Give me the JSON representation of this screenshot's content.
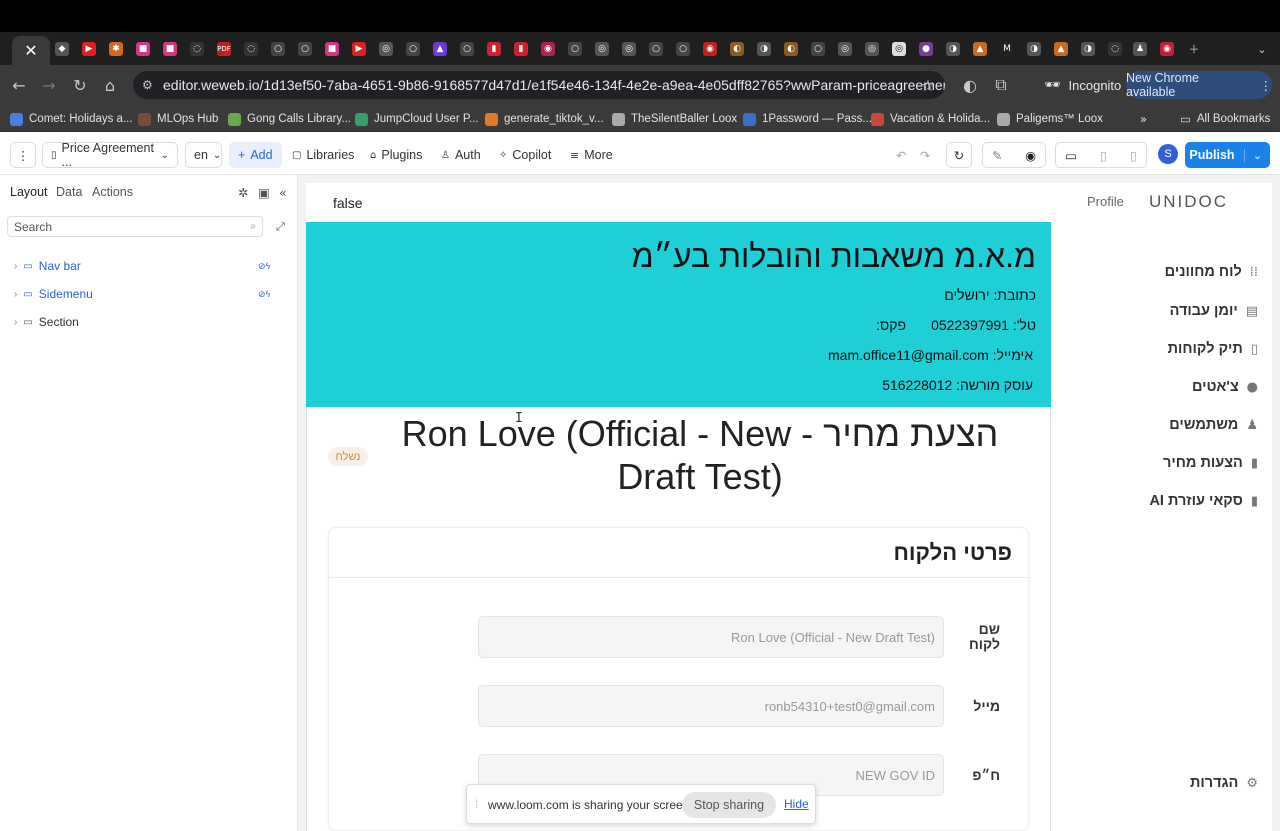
{
  "browser": {
    "url": "editor.weweb.io/1d13ef50-7aba-4651-9b86-9168577d47d1/e1f54e46-134f-4e2e-a9ea-4e05dff82765?wwParam-priceagreement_i...",
    "incognito_label": "Incognito",
    "new_chrome_label": "New Chrome available",
    "bookmarks": [
      {
        "label": "Comet: Holidays a...",
        "color": "#4a7fe0"
      },
      {
        "label": "MLOps Hub",
        "color": "#7a4a3a"
      },
      {
        "label": "Gong Calls Library...",
        "color": "#6aa84f"
      },
      {
        "label": "JumpCloud User P...",
        "color": "#3a9c6a"
      },
      {
        "label": "generate_tiktok_v...",
        "color": "#e07a2a"
      },
      {
        "label": "TheSilentBaller Loox",
        "color": "#aaaaaa"
      },
      {
        "label": "1Password — Pass...",
        "color": "#3a70c8"
      },
      {
        "label": "Vacation & Holida...",
        "color": "#c84a3a"
      },
      {
        "label": "Paligems™ Loox",
        "color": "#aaaaaa"
      }
    ],
    "more_bookmarks_icon": "chevron-double-right-icon",
    "all_bookmarks_label": "All Bookmarks"
  },
  "editor": {
    "page_select": "Price Agreement ...",
    "lang_select": "en",
    "add_label": "Add",
    "libraries_label": "Libraries",
    "plugins_label": "Plugins",
    "auth_label": "Auth",
    "copilot_label": "Copilot",
    "more_label": "More",
    "avatar_letter": "S",
    "publish_label": "Publish"
  },
  "left_panel": {
    "tabs": [
      "Layout",
      "Data",
      "Actions"
    ],
    "search_placeholder": "Search",
    "tree": [
      {
        "label": "Nav bar",
        "color": "#2f62d9"
      },
      {
        "label": "Sidemenu",
        "color": "#2f62d9"
      },
      {
        "label": "Section",
        "color": "#333333"
      }
    ]
  },
  "page": {
    "top_value": "false",
    "profile_label": "Profile",
    "logo_text": "UNIDOC",
    "company": {
      "name": "מ.א.מ משאבות והובלות בע״מ",
      "address": "כתובת: ירושלים",
      "phone": "טל': 0522397991",
      "fax": "פקס:",
      "email": "אימייל: mam.office11@gmail.com",
      "license": "עוסק מורשה: 516228012",
      "bg_color": "#1ecfd6"
    },
    "title": "הצעת מחיר - Ron Love (Official - New Draft Test)",
    "status_badge": "נשלח",
    "nav": [
      {
        "label": "לוח מחוונים",
        "icon": "grid-icon"
      },
      {
        "label": "יומן עבודה",
        "icon": "calendar-icon"
      },
      {
        "label": "תיק לקוחות",
        "icon": "file-icon"
      },
      {
        "label": "צ'אטים",
        "icon": "chat-icon"
      },
      {
        "label": "משתמשים",
        "icon": "users-icon"
      },
      {
        "label": "הצעות מחיר",
        "icon": "document-icon"
      },
      {
        "label": "סקאי עוזרת AI",
        "icon": "clipboard-icon"
      }
    ],
    "settings_label": "הגדרות",
    "customer_card": {
      "title": "פרטי הלקוח",
      "fields": [
        {
          "label": "שם לקוח",
          "value": "Ron Love (Official - New Draft Test)"
        },
        {
          "label": "מייל",
          "value": "ronb54310+test0@gmail.com"
        },
        {
          "label": "ח״פ",
          "value": "NEW GOV ID"
        }
      ]
    }
  },
  "loom": {
    "message": "www.loom.com is sharing your screen.",
    "stop_label": "Stop sharing",
    "hide_label": "Hide"
  }
}
